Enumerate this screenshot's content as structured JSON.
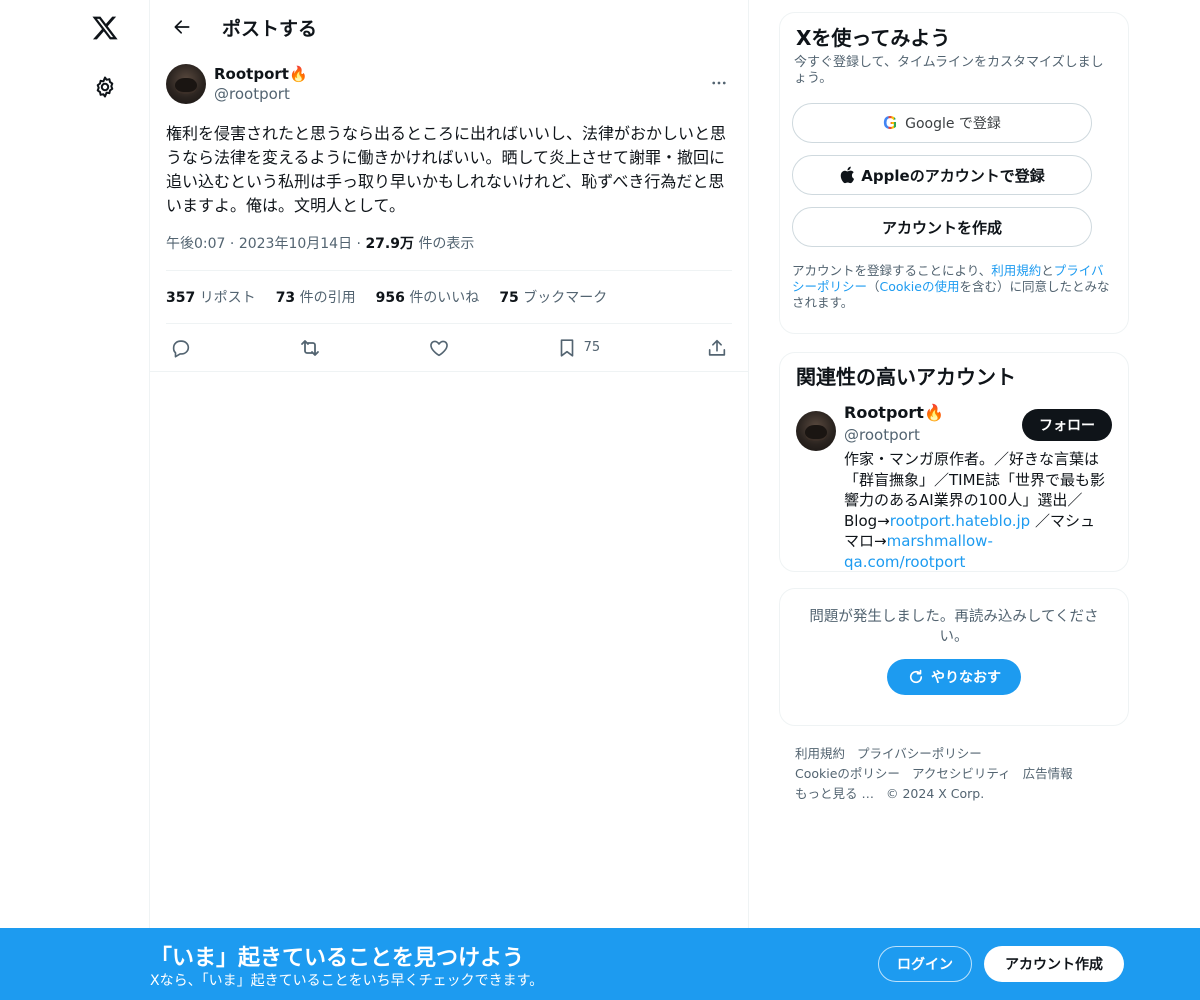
{
  "leftnav": {
    "logo_icon": "x-logo-icon",
    "settings_icon": "gear-icon"
  },
  "header": {
    "title": "ポストする"
  },
  "post": {
    "author_name": "Rootport🔥",
    "author_handle": "@rootport",
    "text": "権利を侵害されたと思うなら出るところに出ればいいし、法律がおかしいと思うなら法律を変えるように働きかければいい。晒して炎上させて謝罪・撤回に追い込むという私刑は手っ取り早いかもしれないけれど、恥ずべき行為だと思いますよ。俺は。文明人として。",
    "time": "午後0:07",
    "date": "2023年10月14日",
    "views_count": "27.9万",
    "views_label": "件の表示",
    "stats": [
      {
        "count": "357",
        "label": "リポスト"
      },
      {
        "count": "73",
        "label": "件の引用"
      },
      {
        "count": "956",
        "label": "件のいいね"
      },
      {
        "count": "75",
        "label": "ブックマーク"
      }
    ],
    "bookmark_count": "75"
  },
  "signup": {
    "title": "Xを使ってみよう",
    "subtitle": "今すぐ登録して、タイムラインをカスタマイズしましょう。",
    "google_label": "Google で登録",
    "apple_label": "Appleのアカウントで登録",
    "create_label": "アカウントを作成",
    "legal_prefix": "アカウントを登録することにより、",
    "legal_terms": "利用規約",
    "legal_and": "と",
    "legal_privacy": "プライバシーポリシー",
    "legal_paren_open": "（",
    "legal_cookie": "Cookieの使用",
    "legal_suffix": "を含む）に同意したとみなされます。"
  },
  "related": {
    "title": "関連性の高いアカウント",
    "name": "Rootport🔥",
    "handle": "@rootport",
    "follow_label": "フォロー",
    "bio_1": "作家・マンガ原作者。／好きな言葉は「群盲撫象」／TIME誌「世界で最も影響力のあるAI業界の100人」選出／Blog→",
    "bio_link_1": "rootport.hateblo.jp",
    "bio_2": " ／マシュマロ→",
    "bio_link_2": "marshmallow-qa.com/rootport"
  },
  "error": {
    "message": "問題が発生しました。再読み込みしてください。",
    "retry_label": "やりなおす"
  },
  "footer": {
    "links": [
      "利用規約",
      "プライバシーポリシー",
      "Cookieのポリシー",
      "アクセシビリティ",
      "広告情報",
      "もっと見る …"
    ],
    "copyright": "© 2024 X Corp."
  },
  "banner": {
    "title": "「いま」起きていることを見つけよう",
    "subtitle": "Xなら、「いま」起きていることをいち早くチェックできます。",
    "login_label": "ログイン",
    "create_label": "アカウント作成"
  },
  "colors": {
    "accent": "#1d9bf0",
    "text": "#0f1419",
    "muted": "#536471",
    "border": "#eff3f4"
  }
}
